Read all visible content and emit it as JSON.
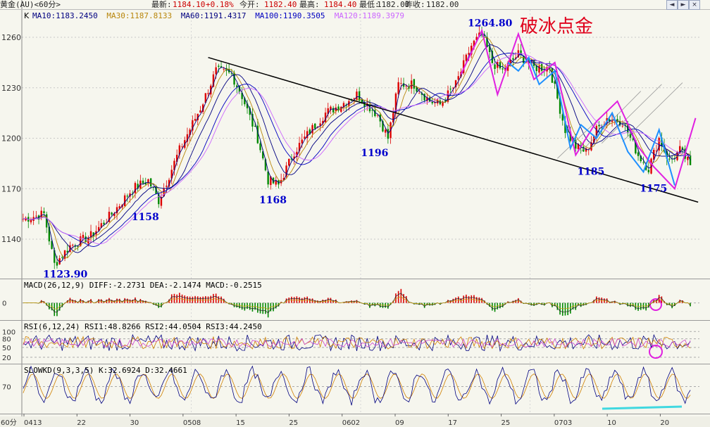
{
  "header": {
    "instrument": "黄金(AU)<60分>",
    "latest_label": "最新:",
    "latest_value": "1184.10",
    "change": "+0.18%",
    "open_label": "今开:",
    "open_value": "1182.40",
    "high_label": "最高:",
    "high_value": "1184.40",
    "low_label": "最低:",
    "low_value": "1182.00",
    "prev_close_label": "昨收:",
    "prev_close_value": "1182.00"
  },
  "main_panel": {
    "label": "K",
    "ma_readouts": [
      {
        "text": "MA10:1183.2450",
        "color": "#000080"
      },
      {
        "text": "MA30:1187.8133",
        "color": "#b8860b"
      },
      {
        "text": "MA60:1191.4317",
        "color": "#000080"
      },
      {
        "text": "MA100:1190.3505",
        "color": "#0000c0"
      },
      {
        "text": "MA120:1189.3979",
        "color": "#cc66ff"
      }
    ],
    "watermark": "破冰点金"
  },
  "macd_panel": {
    "label": "MACD(26,12,9)",
    "diff": "DIFF:-2.2731",
    "dea": "DEA:-2.1474",
    "macd": "MACD:-0.2515"
  },
  "rsi_panel": {
    "label": "RSI(6,12,24)",
    "rsi1": "RSI1:48.8266",
    "rsi2": "RSI2:44.0504",
    "rsi3": "RSI3:44.2450"
  },
  "kd_panel": {
    "label": "SLOWKD(9,3,3,5)",
    "k": "K:32.6924",
    "d": "D:32.4661"
  },
  "nav_buttons": [
    "◄",
    "►",
    "×"
  ],
  "chart_data": [
    {
      "type": "candlestick",
      "title": "黄金(AU)<60分>",
      "ylim": [
        1120,
        1270
      ],
      "yticks": [
        1140,
        1170,
        1200,
        1230,
        1260
      ],
      "x_tick_labels": [
        "0413",
        "22",
        "30",
        "0508",
        "15",
        "25",
        "0602",
        "09",
        "17",
        "25",
        "0703",
        "10",
        "20"
      ],
      "key_points": [
        {
          "label": "1123.90",
          "value": 1123.9,
          "kind": "low"
        },
        {
          "label": "1158",
          "value": 1158,
          "kind": "low"
        },
        {
          "label": "1168",
          "value": 1168,
          "kind": "low"
        },
        {
          "label": "1196",
          "value": 1196,
          "kind": "low"
        },
        {
          "label": "1264.80",
          "value": 1264.8,
          "kind": "high"
        },
        {
          "label": "1185",
          "value": 1185,
          "kind": "low"
        },
        {
          "label": "1175",
          "value": 1175,
          "kind": "low"
        }
      ],
      "anchors": [
        [
          0,
          1152
        ],
        [
          8,
          1155
        ],
        [
          12,
          1125
        ],
        [
          18,
          1136
        ],
        [
          26,
          1142
        ],
        [
          34,
          1155
        ],
        [
          42,
          1170
        ],
        [
          48,
          1175
        ],
        [
          52,
          1163
        ],
        [
          60,
          1193
        ],
        [
          68,
          1218
        ],
        [
          74,
          1240
        ],
        [
          80,
          1238
        ],
        [
          84,
          1225
        ],
        [
          90,
          1200
        ],
        [
          94,
          1175
        ],
        [
          98,
          1172
        ],
        [
          104,
          1192
        ],
        [
          110,
          1204
        ],
        [
          116,
          1215
        ],
        [
          122,
          1220
        ],
        [
          128,
          1226
        ],
        [
          136,
          1214
        ],
        [
          140,
          1200
        ],
        [
          144,
          1232
        ],
        [
          150,
          1232
        ],
        [
          156,
          1222
        ],
        [
          160,
          1220
        ],
        [
          166,
          1232
        ],
        [
          172,
          1255
        ],
        [
          176,
          1262
        ],
        [
          180,
          1245
        ],
        [
          184,
          1240
        ],
        [
          190,
          1250
        ],
        [
          196,
          1242
        ],
        [
          202,
          1242
        ],
        [
          208,
          1205
        ],
        [
          212,
          1195
        ],
        [
          216,
          1192
        ],
        [
          220,
          1205
        ],
        [
          224,
          1212
        ],
        [
          230,
          1210
        ],
        [
          236,
          1190
        ],
        [
          240,
          1182
        ],
        [
          244,
          1200
        ],
        [
          248,
          1186
        ],
        [
          252,
          1193
        ],
        [
          256,
          1184
        ]
      ]
    },
    {
      "type": "macd",
      "series_labels": [
        "DIFF",
        "DEA",
        "MACD"
      ],
      "yticks": [
        0
      ]
    },
    {
      "type": "rsi",
      "series_labels": [
        "RSI1",
        "RSI2",
        "RSI3"
      ],
      "yticks": [
        20,
        50,
        80,
        100
      ]
    },
    {
      "type": "slowkd",
      "series_labels": [
        "K",
        "D"
      ],
      "yticks": [
        70
      ]
    }
  ],
  "annotations": [
    {
      "kind": "label",
      "text": "1123.90",
      "x": 13,
      "y": 1123.9,
      "color": "#0000cc"
    },
    {
      "kind": "label",
      "text": "1158",
      "x": 47,
      "y": 1158,
      "color": "#0000cc"
    },
    {
      "kind": "label",
      "text": "1168",
      "x": 96,
      "y": 1168,
      "color": "#0000cc"
    },
    {
      "kind": "label",
      "text": "1196",
      "x": 135,
      "y": 1196,
      "color": "#0000cc"
    },
    {
      "kind": "label",
      "text": "1264.80",
      "x": 176,
      "y": 1264.8,
      "color": "#0000cc"
    },
    {
      "kind": "label",
      "text": "1185",
      "x": 218,
      "y": 1185,
      "color": "#0000cc"
    },
    {
      "kind": "label",
      "text": "1175",
      "x": 242,
      "y": 1175,
      "color": "#0000cc"
    }
  ],
  "colors": {
    "up": "#dd0000",
    "down": "#008800",
    "trend": "#000000",
    "wave": "#e020e0",
    "blue_wave": "#1e90ff",
    "label": "#0000cc",
    "watermark": "#e0001b"
  }
}
